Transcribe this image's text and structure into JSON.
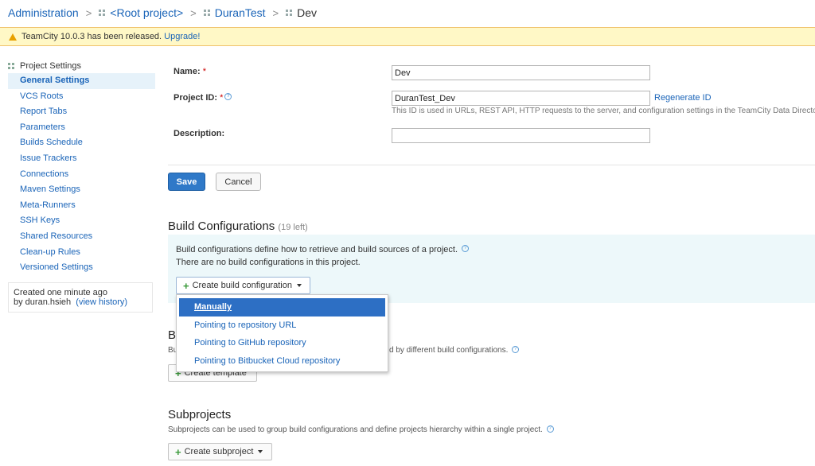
{
  "breadcrumb": {
    "admin": "Administration",
    "root": "<Root project>",
    "project": "DuranTest",
    "current": "Dev",
    "separator": ">"
  },
  "notice": {
    "text": "TeamCity 10.0.3 has been released.",
    "link": "Upgrade!",
    "icon": "warning-icon"
  },
  "sidebar": {
    "title": "Project Settings",
    "items": [
      {
        "label": "General Settings",
        "active": true
      },
      {
        "label": "VCS Roots"
      },
      {
        "label": "Report Tabs"
      },
      {
        "label": "Parameters"
      },
      {
        "label": "Builds Schedule"
      },
      {
        "label": "Issue Trackers"
      },
      {
        "label": "Connections"
      },
      {
        "label": "Maven Settings"
      },
      {
        "label": "Meta-Runners"
      },
      {
        "label": "SSH Keys"
      },
      {
        "label": "Shared Resources"
      },
      {
        "label": "Clean-up Rules"
      },
      {
        "label": "Versioned Settings"
      }
    ],
    "created": {
      "line1": "Created one minute ago",
      "by": "by duran.hsieh",
      "history_link": "(view history)"
    }
  },
  "form": {
    "name_label": "Name:",
    "name_value": "Dev",
    "id_label": "Project ID:",
    "id_value": "DuranTest_Dev",
    "regenerate": "Regenerate ID",
    "id_hint": "This ID is used in URLs, REST API, HTTP requests to the server, and configuration settings in the TeamCity Data Directory.",
    "description_label": "Description:",
    "description_value": "",
    "required_mark": "*",
    "help_mark": "?",
    "save": "Save",
    "cancel": "Cancel"
  },
  "build_configs": {
    "heading": "Build Configurations",
    "count": "(19 left)",
    "desc": "Build configurations define how to retrieve and build sources of a project.",
    "empty": "There are no build configurations in this project.",
    "create_button": "Create build configuration",
    "menu": [
      "Manually",
      "Pointing to repository URL",
      "Pointing to GitHub repository",
      "Pointing to Bitbucket Cloud repository"
    ],
    "menu_selected": "Manually"
  },
  "templates": {
    "heading_visible": "Bu",
    "desc_visible_start": "Bu",
    "desc_visible_end": "d by different build configurations.",
    "create_button": "Create template"
  },
  "subprojects": {
    "heading": "Subprojects",
    "desc": "Subprojects can be used to group build configurations and define projects hierarchy within a single project.",
    "create_button": "Create subproject"
  },
  "colors": {
    "link": "#1a64b8",
    "notice_bg": "#fff8c6",
    "primary_button": "#2f79c8",
    "menu_selected": "#2d6fc4",
    "info_bg": "#edf8fa"
  }
}
